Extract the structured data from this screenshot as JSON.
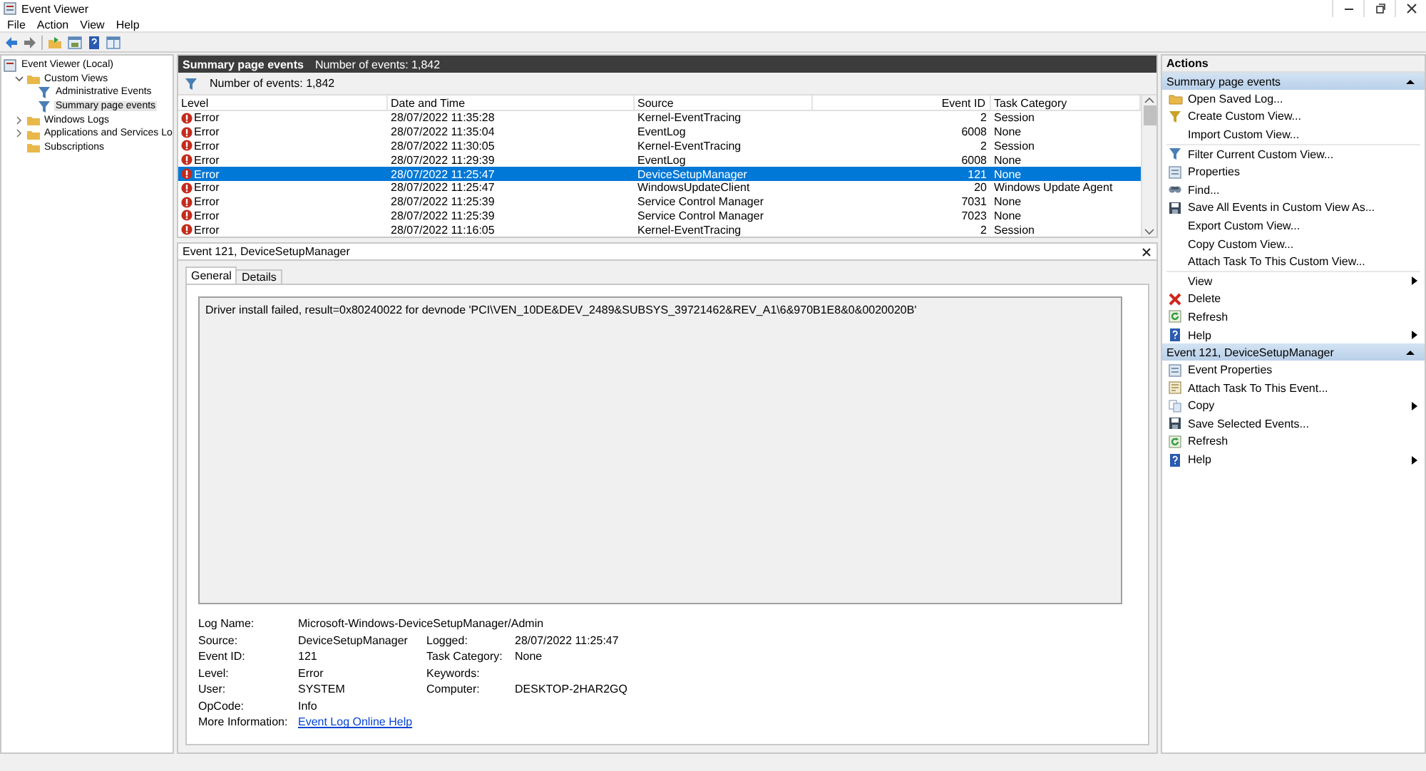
{
  "window": {
    "title": "Event Viewer"
  },
  "menu": [
    "File",
    "Action",
    "View",
    "Help"
  ],
  "tree": [
    {
      "label": "Event Viewer (Local)",
      "selected": false,
      "children": [
        {
          "label": "Custom Views",
          "selected": false,
          "expanded": true,
          "children": [
            {
              "label": "Administrative Events",
              "selected": false
            },
            {
              "label": "Summary page events",
              "selected": true
            }
          ]
        },
        {
          "label": "Windows Logs",
          "selected": false,
          "expanded": false
        },
        {
          "label": "Applications and Services Lo",
          "selected": false,
          "expanded": false
        },
        {
          "label": "Subscriptions",
          "selected": false
        }
      ]
    }
  ],
  "events": {
    "title": "Summary page events",
    "count": "Number of events: 1,842",
    "filter_text": "Number of events: 1,842",
    "columns": [
      "Level",
      "Date and Time",
      "Source",
      "Event ID",
      "Task Category"
    ],
    "rows": [
      {
        "level": "Error",
        "date": "28/07/2022 11:35:28",
        "source": "Kernel-EventTracing",
        "event_id": "2",
        "category": "Session",
        "selected": false
      },
      {
        "level": "Error",
        "date": "28/07/2022 11:35:04",
        "source": "EventLog",
        "event_id": "6008",
        "category": "None",
        "selected": false
      },
      {
        "level": "Error",
        "date": "28/07/2022 11:30:05",
        "source": "Kernel-EventTracing",
        "event_id": "2",
        "category": "Session",
        "selected": false
      },
      {
        "level": "Error",
        "date": "28/07/2022 11:29:39",
        "source": "EventLog",
        "event_id": "6008",
        "category": "None",
        "selected": false
      },
      {
        "level": "Error",
        "date": "28/07/2022 11:25:47",
        "source": "DeviceSetupManager",
        "event_id": "121",
        "category": "None",
        "selected": true
      },
      {
        "level": "Error",
        "date": "28/07/2022 11:25:47",
        "source": "WindowsUpdateClient",
        "event_id": "20",
        "category": "Windows Update Agent",
        "selected": false
      },
      {
        "level": "Error",
        "date": "28/07/2022 11:25:39",
        "source": "Service Control Manager",
        "event_id": "7031",
        "category": "None",
        "selected": false
      },
      {
        "level": "Error",
        "date": "28/07/2022 11:25:39",
        "source": "Service Control Manager",
        "event_id": "7023",
        "category": "None",
        "selected": false
      },
      {
        "level": "Error",
        "date": "28/07/2022 11:16:05",
        "source": "Kernel-EventTracing",
        "event_id": "2",
        "category": "Session",
        "selected": false
      }
    ]
  },
  "detail": {
    "title": "Event 121, DeviceSetupManager",
    "tabs": [
      {
        "label": "General",
        "selected": true
      },
      {
        "label": "Details",
        "selected": false
      }
    ],
    "message": "Driver install failed, result=0x80240022 for devnode 'PCI\\VEN_10DE&DEV_2489&SUBSYS_39721462&REV_A1\\6&970B1E8&0&0020020B'",
    "fields": [
      [
        {
          "label": "Log Name:",
          "value": "Microsoft-Windows-DeviceSetupManager/Admin"
        }
      ],
      [
        {
          "label": "Source:",
          "value": "DeviceSetupManager"
        },
        {
          "label": "Logged:",
          "value": "28/07/2022 11:25:47"
        }
      ],
      [
        {
          "label": "Event ID:",
          "value": "121"
        },
        {
          "label": "Task Category:",
          "value": "None"
        }
      ],
      [
        {
          "label": "Level:",
          "value": "Error"
        },
        {
          "label": "Keywords:"
        }
      ],
      [
        {
          "label": "User:",
          "value": "SYSTEM"
        },
        {
          "label": "Computer:",
          "value": "DESKTOP-2HAR2GQ"
        }
      ],
      [
        {
          "label": "OpCode:",
          "value": "Info"
        }
      ],
      [
        {
          "label": "More Information:",
          "link": "Event Log Online Help"
        }
      ]
    ]
  },
  "actions": {
    "title": "Actions",
    "sections": [
      {
        "title": "Summary page events",
        "expanded": true,
        "items": [
          {
            "label": "Open Saved Log...",
            "submenu": false
          },
          {
            "label": "Create Custom View...",
            "submenu": false
          },
          {
            "label": "Import Custom View...",
            "submenu": false
          },
          {
            "label": "Filter Current Custom View...",
            "submenu": false
          },
          {
            "label": "Properties",
            "submenu": false
          },
          {
            "label": "Find...",
            "submenu": false
          },
          {
            "label": "Save All Events in Custom View As...",
            "submenu": false
          },
          {
            "label": "Export Custom View...",
            "submenu": false
          },
          {
            "label": "Copy Custom View...",
            "submenu": false
          },
          {
            "label": "Attach Task To This Custom View...",
            "submenu": false
          },
          {
            "label": "View",
            "submenu": true
          },
          {
            "label": "Delete",
            "submenu": false
          },
          {
            "label": "Refresh",
            "submenu": false
          },
          {
            "label": "Help",
            "submenu": true
          }
        ]
      },
      {
        "title": "Event 121, DeviceSetupManager",
        "expanded": true,
        "items": [
          {
            "label": "Event Properties",
            "submenu": false
          },
          {
            "label": "Attach Task To This Event...",
            "submenu": false
          },
          {
            "label": "Copy",
            "submenu": true
          },
          {
            "label": "Save Selected Events...",
            "submenu": false
          },
          {
            "label": "Refresh",
            "submenu": false
          },
          {
            "label": "Help",
            "submenu": true
          }
        ]
      }
    ]
  }
}
